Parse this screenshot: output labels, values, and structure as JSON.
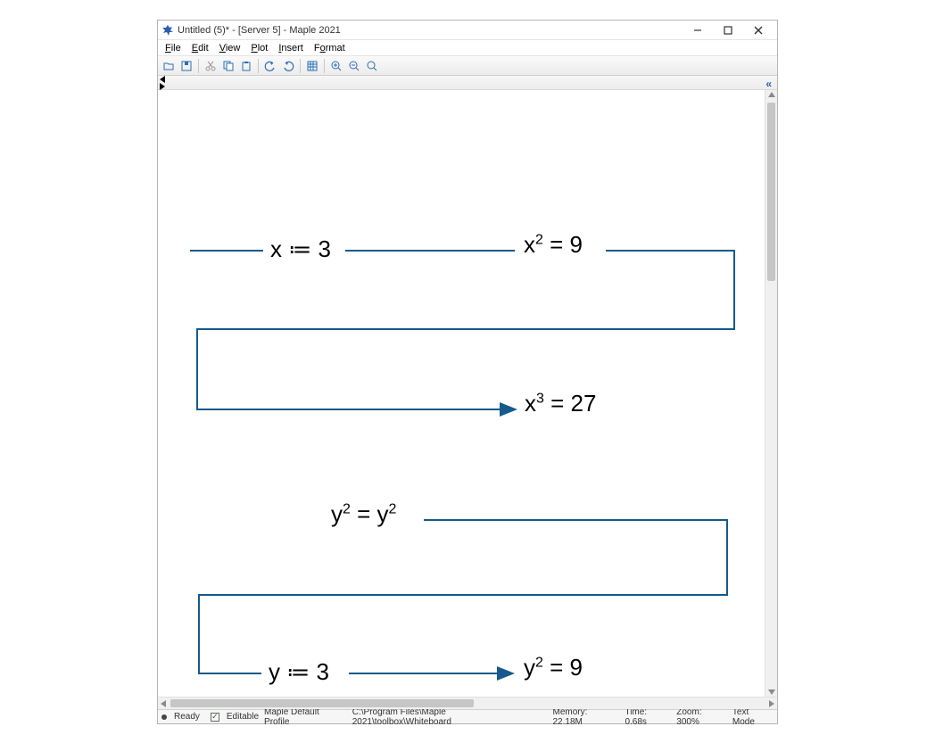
{
  "window": {
    "title": "Untitled (5)* - [Server 5] - Maple 2021"
  },
  "menu": {
    "file": "File",
    "edit": "Edit",
    "view": "View",
    "plot": "Plot",
    "insert": "Insert",
    "format": "Format"
  },
  "toolbar_icons": {
    "open": "open-icon",
    "save": "save-icon",
    "cut": "cut-icon",
    "copy": "copy-icon",
    "paste": "paste-icon",
    "undo": "undo-icon",
    "redo": "redo-icon",
    "grid": "grid-icon",
    "zoom_in": "zoom-in-icon",
    "zoom_out": "zoom-out-icon",
    "zoom_fit": "zoom-fit-icon"
  },
  "ruler": {
    "collapse_label": "«"
  },
  "canvas_math": {
    "step1": "x ≔ 3",
    "step2_base": "x",
    "step2_exp": "2",
    "step2_res": " = 9",
    "step3_base": "x",
    "step3_exp": "3",
    "step3_res": " = 27",
    "step4a_base": "y",
    "step4a_exp": "2",
    "step4_mid": " = y",
    "step4b_exp": "2",
    "step5": "y ≔ 3",
    "step6_base": "y",
    "step6_exp": "2",
    "step6_res": " = 9"
  },
  "status": {
    "ready": "Ready",
    "editable": "Editable",
    "profile": "Maple Default Profile",
    "path": "C:\\Program Files\\Maple 2021\\toolbox\\Whiteboard",
    "memory": "Memory: 22.18M",
    "time": "Time: 0.68s",
    "zoom": "Zoom: 300%",
    "mode": "Text Mode"
  }
}
